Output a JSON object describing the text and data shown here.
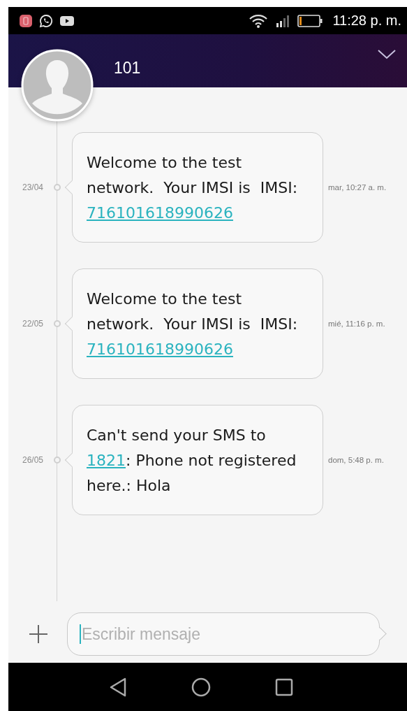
{
  "status_bar": {
    "time": "11:28 p. m."
  },
  "contact": {
    "name": "101"
  },
  "messages": [
    {
      "date": "23/04",
      "time": "mar, 10:27 a. m.",
      "parts": [
        {
          "kind": "text",
          "text": "Welcome to the test network.  Your IMSI is  IMSI: "
        },
        {
          "kind": "link",
          "text": "716101618990626"
        }
      ]
    },
    {
      "date": "22/05",
      "time": "mié, 11:16 p. m.",
      "parts": [
        {
          "kind": "text",
          "text": "Welcome to the test network.  Your IMSI is  IMSI: "
        },
        {
          "kind": "link",
          "text": "716101618990626"
        }
      ]
    },
    {
      "date": "26/05",
      "time": "dom, 5:48 p. m.",
      "parts": [
        {
          "kind": "text",
          "text": "Can't send your SMS to "
        },
        {
          "kind": "link",
          "text": "1821"
        },
        {
          "kind": "text",
          "text": ": Phone not registered here.: Hola"
        }
      ]
    }
  ],
  "composer": {
    "placeholder": "Escribir mensaje"
  }
}
